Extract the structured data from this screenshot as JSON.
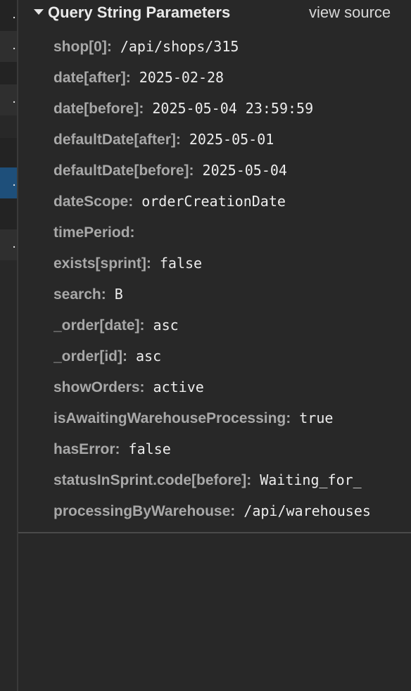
{
  "section": {
    "title": "Query String Parameters",
    "view_source_label": "view source"
  },
  "left_list": {
    "row_marker": "."
  },
  "params": [
    {
      "key": "shop[0]",
      "value": "/api/shops/315"
    },
    {
      "key": "date[after]",
      "value": "2025-02-28"
    },
    {
      "key": "date[before]",
      "value": "2025-05-04 23:59:59"
    },
    {
      "key": "defaultDate[after]",
      "value": "2025-05-01"
    },
    {
      "key": "defaultDate[before]",
      "value": "2025-05-04"
    },
    {
      "key": "dateScope",
      "value": "orderCreationDate"
    },
    {
      "key": "timePeriod",
      "value": ""
    },
    {
      "key": "exists[sprint]",
      "value": "false"
    },
    {
      "key": "search",
      "value": "B"
    },
    {
      "key": "_order[date]",
      "value": "asc"
    },
    {
      "key": "_order[id]",
      "value": "asc"
    },
    {
      "key": "showOrders",
      "value": "active"
    },
    {
      "key": "isAwaitingWarehouseProcessing",
      "value": "true"
    },
    {
      "key": "hasError",
      "value": "false"
    },
    {
      "key": "statusInSprint.code[before]",
      "value": "Waiting_for_"
    },
    {
      "key": "processingByWarehouse",
      "value": "/api/warehouses"
    }
  ]
}
